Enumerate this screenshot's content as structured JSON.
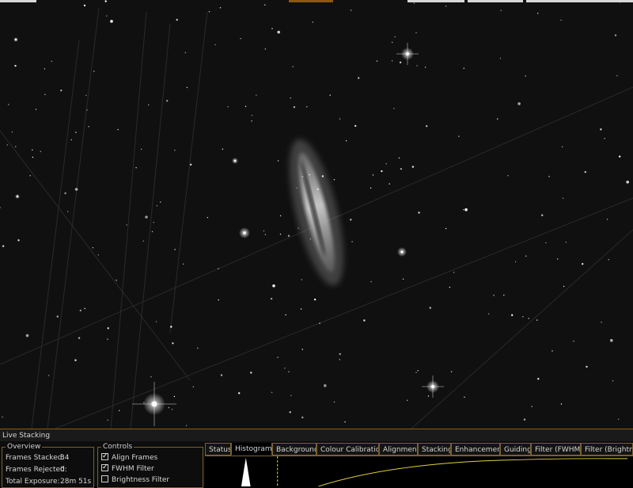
{
  "panel": {
    "title": "Live Stacking"
  },
  "overview": {
    "legend": "Overview",
    "frames_stacked_label": "Frames Stacked:",
    "frames_stacked_value": "34",
    "frames_rejected_label": "Frames Rejected:",
    "frames_rejected_value": "0",
    "total_exposure_label": "Total Exposure:",
    "total_exposure_value": "28m 51s"
  },
  "controls": {
    "legend": "Controls",
    "align_frames": {
      "label": "Align Frames",
      "checked": true
    },
    "fwhm_filter": {
      "label": "FWHM Filter",
      "checked": true
    },
    "brightness_filter": {
      "label": "Brightness Filter",
      "checked": false
    }
  },
  "tabs": [
    {
      "label": "Status",
      "active": false
    },
    {
      "label": "Histogram",
      "active": true
    },
    {
      "label": "Background",
      "active": false
    },
    {
      "label": "Colour Calibration",
      "active": false
    },
    {
      "label": "Alignment",
      "active": false
    },
    {
      "label": "Stacking",
      "active": false
    },
    {
      "label": "Enhancement",
      "active": false
    },
    {
      "label": "Guiding",
      "active": false
    },
    {
      "label": "Filter (FWHM)",
      "active": false
    },
    {
      "label": "Filter (Brightness)",
      "active": false
    }
  ],
  "colors": {
    "accent_border": "#7a6030",
    "histogram_curve": "#e0d040",
    "histogram_marker": "#f0e020"
  }
}
